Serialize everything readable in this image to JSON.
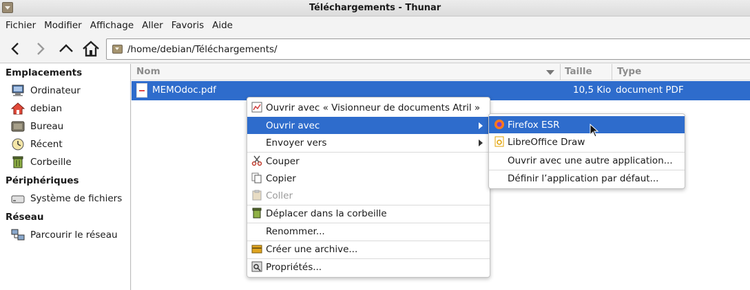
{
  "window": {
    "title": "Téléchargements - Thunar"
  },
  "menubar": [
    "Fichier",
    "Modifier",
    "Affichage",
    "Aller",
    "Favoris",
    "Aide"
  ],
  "location": {
    "path": "/home/debian/Téléchargements/"
  },
  "sidebar": {
    "sections": [
      {
        "title": "Emplacements",
        "items": [
          "Ordinateur",
          "debian",
          "Bureau",
          "Récent",
          "Corbeille"
        ]
      },
      {
        "title": "Périphériques",
        "items": [
          "Système de fichiers"
        ]
      },
      {
        "title": "Réseau",
        "items": [
          "Parcourir le réseau"
        ]
      }
    ]
  },
  "columns": {
    "name": "Nom",
    "size": "Taille",
    "type": "Type"
  },
  "files": [
    {
      "name": "MEMOdoc.pdf",
      "size": "10,5 Kio",
      "type": "document PDF",
      "selected": true
    }
  ],
  "context_menu": {
    "items": [
      {
        "label": "Ouvrir avec « Visionneur de documents Atril »"
      },
      {
        "label": "Ouvrir avec",
        "submenu": true,
        "highlighted": true
      },
      {
        "label": "Envoyer vers",
        "submenu": true
      },
      {
        "label": "Couper"
      },
      {
        "label": "Copier"
      },
      {
        "label": "Coller",
        "disabled": true
      },
      {
        "label": "Déplacer dans la corbeille"
      },
      {
        "label": "Renommer..."
      },
      {
        "label": "Créer une archive..."
      },
      {
        "label": "Propriétés..."
      }
    ]
  },
  "submenu": {
    "items": [
      {
        "label": "Firefox ESR",
        "highlighted": true
      },
      {
        "label": "LibreOffice Draw"
      },
      {
        "label": "Ouvrir avec une autre application..."
      },
      {
        "label": "Définir l’application par défaut..."
      }
    ]
  },
  "colors": {
    "selection": "#2e6ccc",
    "background": "#ffffff",
    "chrome": "#f3f3f3"
  }
}
